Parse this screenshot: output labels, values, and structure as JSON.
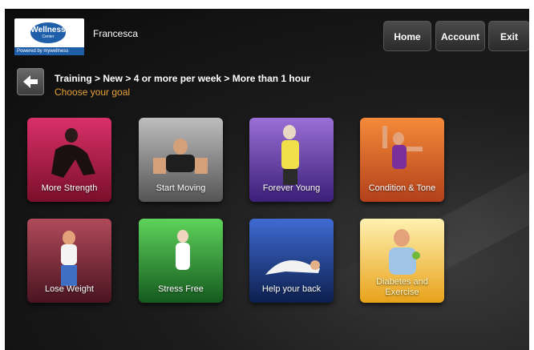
{
  "header": {
    "logo": {
      "text": "Wellness",
      "subtext": "Center",
      "bar_text": "Powered by mywellness"
    },
    "user_name": "Francesca",
    "buttons": {
      "home": "Home",
      "account": "Account",
      "exit": "Exit"
    }
  },
  "nav": {
    "back_icon": "arrow-left-icon",
    "breadcrumb": "Training > New > 4 or more per week > More than 1 hour",
    "prompt": "Choose your goal"
  },
  "goals": [
    {
      "label": "More Strength",
      "color": "#b01a3e"
    },
    {
      "label": "Start Moving",
      "color": "#7d7d7d"
    },
    {
      "label": "Forever Young",
      "color": "#6a3fa8"
    },
    {
      "label": "Condition & Tone",
      "color": "#e3652a"
    },
    {
      "label": "Lose Weight",
      "color": "#8a2a3a"
    },
    {
      "label": "Stress Free",
      "color": "#2f9a3b"
    },
    {
      "label": "Help your back",
      "color": "#1e3d86"
    },
    {
      "label": "Diabetes and Exercise",
      "color": "#f1b92e"
    }
  ]
}
